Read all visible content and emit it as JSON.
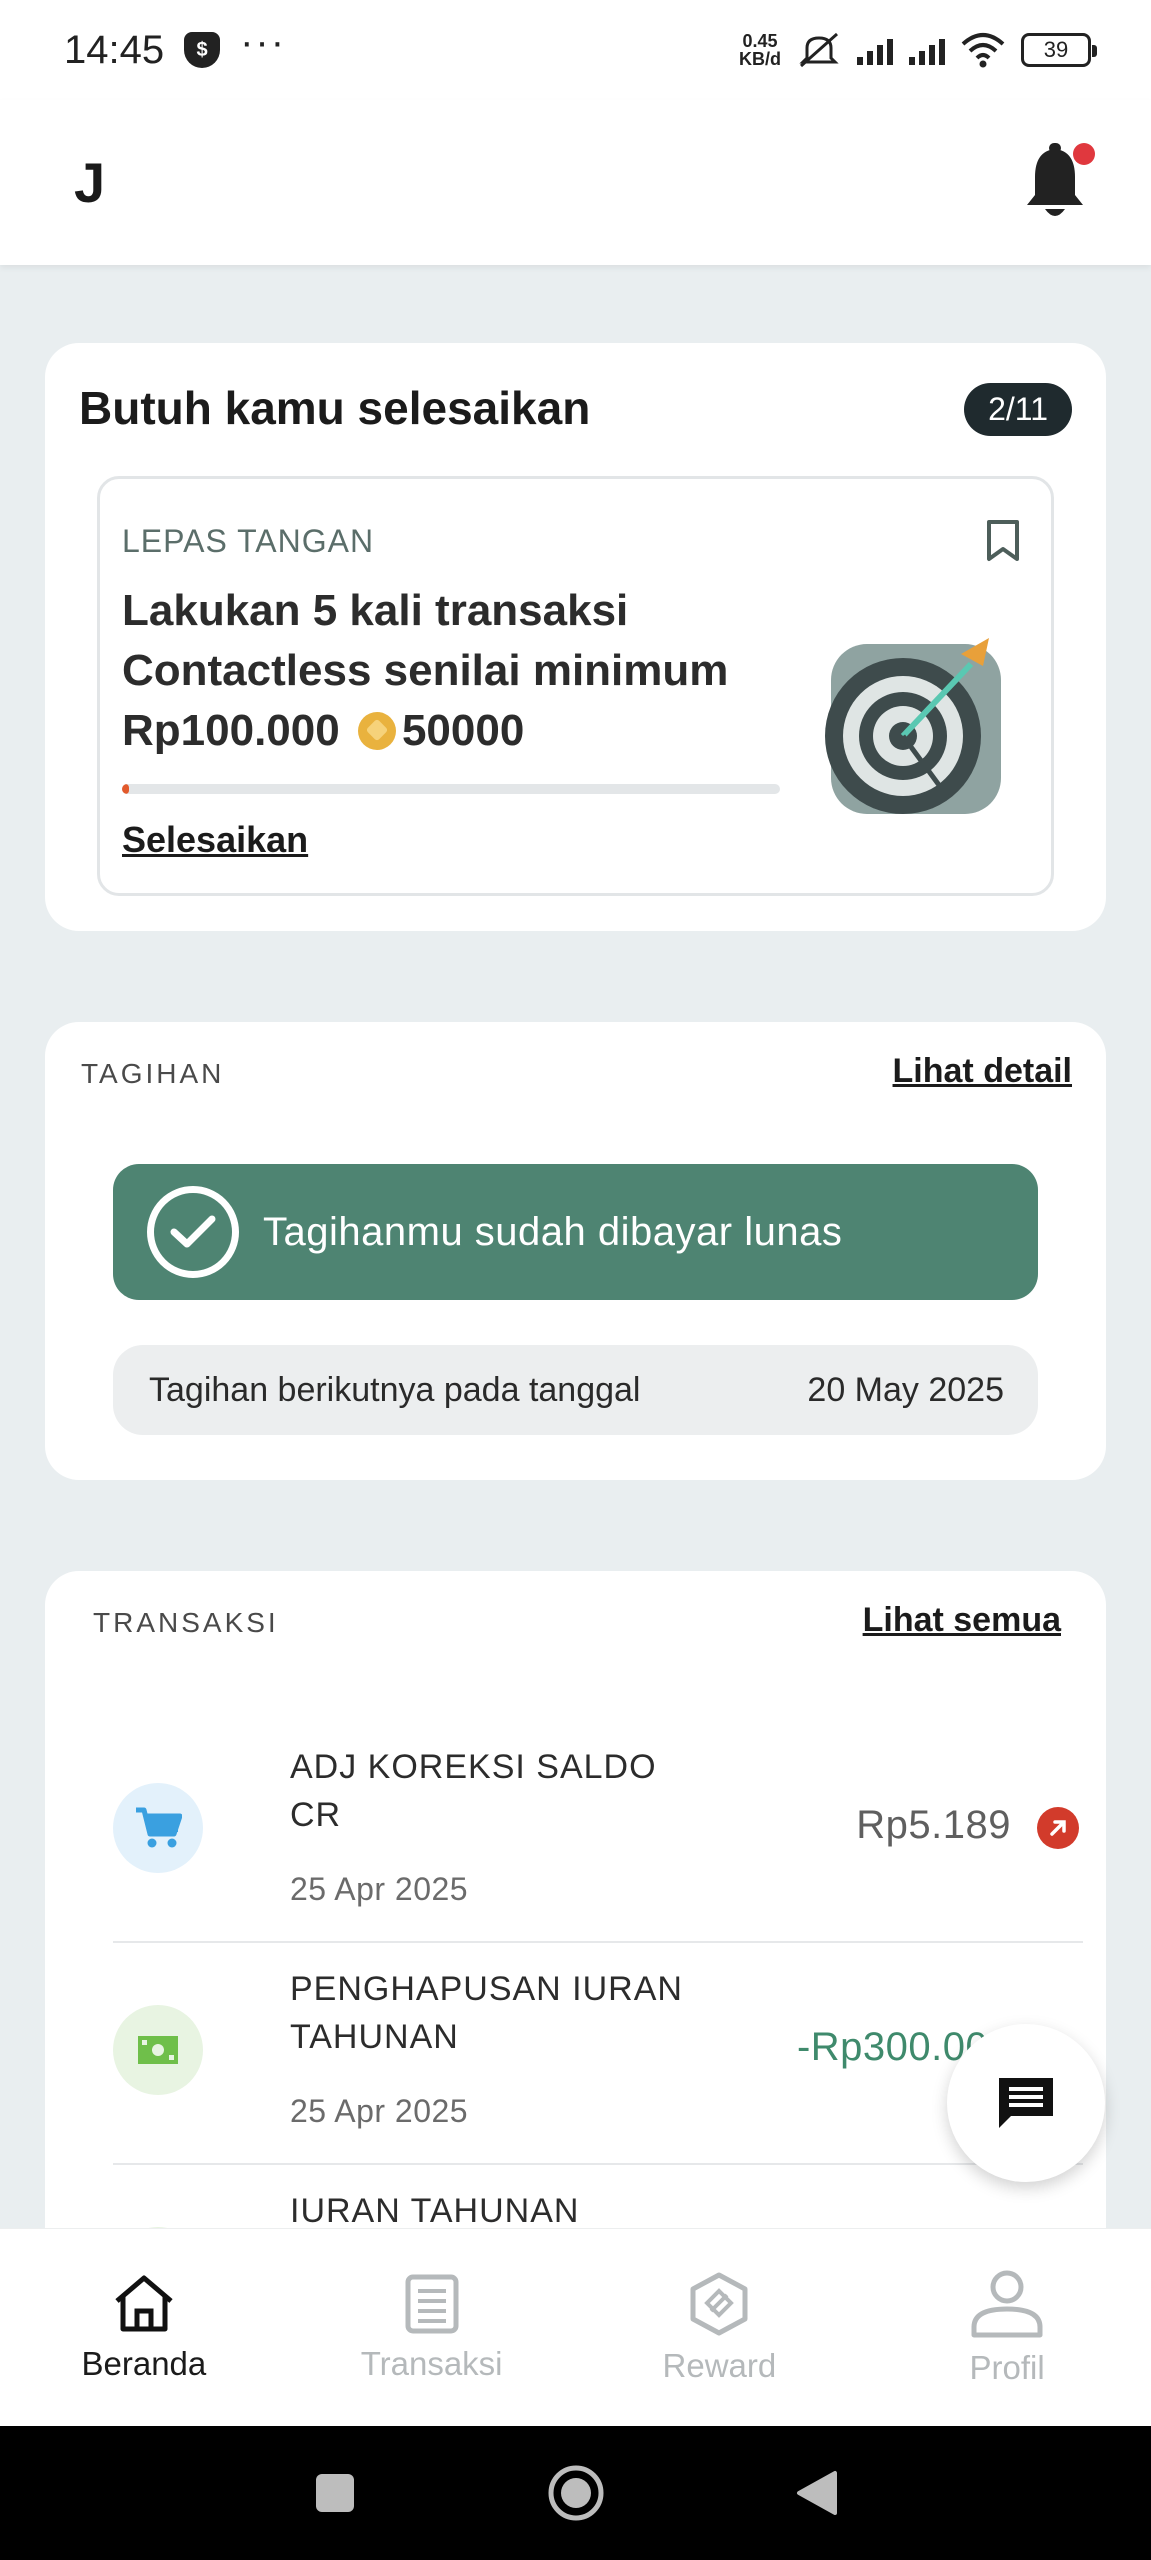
{
  "status_bar": {
    "time": "14:45",
    "notification_icon": "shield-dollar-icon",
    "more": "···",
    "net_speed_value": "0.45",
    "net_speed_unit": "KB/d",
    "battery": "39"
  },
  "header": {
    "user_initial": "J",
    "notification_dot_color": "#e0383e"
  },
  "todo": {
    "title": "Butuh kamu selesaikan",
    "count": "2/11",
    "task": {
      "category": "LEPAS TANGAN",
      "description": "Lakukan 5 kali transaksi Contactless senilai minimum Rp100.000",
      "reward": "50000",
      "progress": 0.01,
      "action": "Selesaikan"
    }
  },
  "bill": {
    "label": "TAGIHAN",
    "link": "Lihat detail",
    "paid_message": "Tagihanmu sudah dibayar lunas",
    "next_label": "Tagihan berikutnya pada tanggal",
    "next_date": "20 May 2025",
    "accent": "#4e8472"
  },
  "transactions": {
    "label": "TRANSAKSI",
    "link": "Lihat semua",
    "items": [
      {
        "name": "ADJ KOREKSI SALDO CR",
        "date": "25 Apr 2025",
        "amount": "Rp5.189",
        "icon": "cart-icon",
        "amount_color": "#5f5f5f"
      },
      {
        "name": "PENGHAPUSAN IURAN TAHUNAN",
        "date": "25 Apr 2025",
        "amount": "-Rp300.000",
        "icon": "cash-icon",
        "amount_color": "#3f8a6c"
      },
      {
        "name": "IURAN TAHUNAN",
        "date": "",
        "amount": "",
        "icon": "cash-icon",
        "amount_color": "#3f8a6c"
      }
    ]
  },
  "bottom_nav": [
    {
      "label": "Beranda",
      "icon": "home-icon",
      "active": true
    },
    {
      "label": "Transaksi",
      "icon": "receipt-icon",
      "active": false
    },
    {
      "label": "Reward",
      "icon": "reward-icon",
      "active": false
    },
    {
      "label": "Profil",
      "icon": "profile-icon",
      "active": false
    }
  ]
}
